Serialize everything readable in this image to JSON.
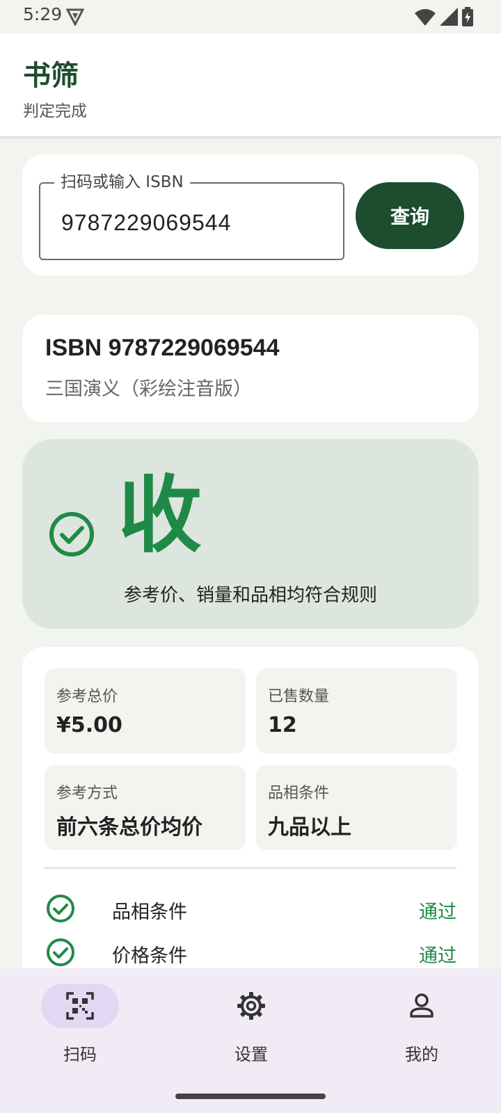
{
  "status_bar": {
    "time": "5:29"
  },
  "app_bar": {
    "title": "书筛",
    "subtitle": "判定完成"
  },
  "search": {
    "field_label": "扫码或输入 ISBN",
    "value": "9787229069544",
    "query_button": "查询"
  },
  "book": {
    "isbn_line": "ISBN 9787229069544",
    "title": "三国演义（彩绘注音版）"
  },
  "verdict": {
    "result": "收",
    "reason": "参考价、销量和品相均符合规则",
    "accent_color": "#1f8a47",
    "background_color": "#dde6de"
  },
  "stats": [
    {
      "label": "参考总价",
      "value": "¥5.00"
    },
    {
      "label": "已售数量",
      "value": "12"
    },
    {
      "label": "参考方式",
      "value": "前六条总价均价"
    },
    {
      "label": "品相条件",
      "value": "九品以上"
    }
  ],
  "checks": [
    {
      "label": "品相条件",
      "status": "通过",
      "icon": "check-circle-icon"
    },
    {
      "label": "价格条件",
      "status": "通过",
      "icon": "check-circle-icon"
    }
  ],
  "nav": [
    {
      "label": "扫码",
      "icon": "qr-scan-icon",
      "active": true
    },
    {
      "label": "设置",
      "icon": "gear-icon",
      "active": false
    },
    {
      "label": "我的",
      "icon": "person-icon",
      "active": false
    }
  ],
  "theme": {
    "primary": "#1b4d2e",
    "nav_background": "#f1ebf6",
    "nav_active_pill": "#e3d8f3"
  }
}
